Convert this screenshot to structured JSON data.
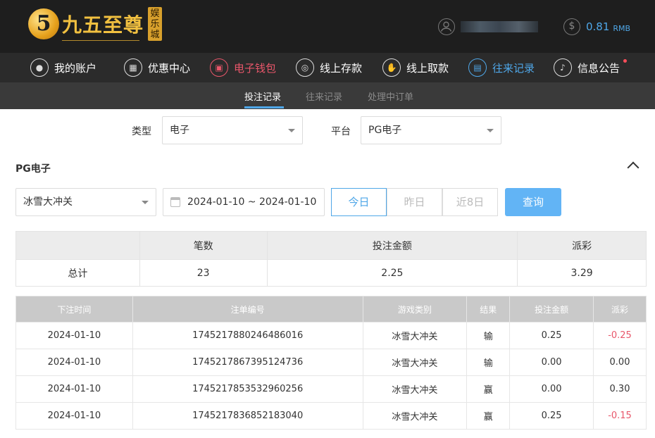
{
  "header": {
    "logo_badge": "5",
    "logo_text": "九五至尊",
    "logo_tag": "娱乐城",
    "balance": "0.81",
    "balance_unit": "RMB"
  },
  "nav": [
    {
      "label": "我的账户",
      "icon": "user-icon"
    },
    {
      "label": "优惠中心",
      "icon": "gift-icon"
    },
    {
      "label": "电子钱包",
      "icon": "wallet-icon"
    },
    {
      "label": "线上存款",
      "icon": "deposit-icon"
    },
    {
      "label": "线上取款",
      "icon": "withdraw-icon"
    },
    {
      "label": "往来记录",
      "icon": "records-icon"
    },
    {
      "label": "信息公告",
      "icon": "bell-icon"
    }
  ],
  "subtabs": [
    "投注记录",
    "往来记录",
    "处理中订单"
  ],
  "filters": {
    "type_label": "类型",
    "type_value": "电子",
    "platform_label": "平台",
    "platform_value": "PG电子"
  },
  "section_title": "PG电子",
  "game_select": "冰雪大冲关",
  "date_range": "2024-01-10 ~ 2024-01-10",
  "range_buttons": [
    "今日",
    "昨日",
    "近8日"
  ],
  "query_label": "查询",
  "summary": {
    "headers": [
      "",
      "笔数",
      "投注金额",
      "派彩"
    ],
    "row": [
      "总计",
      "23",
      "2.25",
      "3.29"
    ]
  },
  "records": {
    "headers": [
      "下注时间",
      "注单编号",
      "游戏类别",
      "结果",
      "投注金额",
      "派彩"
    ],
    "rows": [
      [
        "2024-01-10",
        "1745217880246486016",
        "冰雪大冲关",
        "输",
        "0.25",
        "-0.25"
      ],
      [
        "2024-01-10",
        "1745217867395124736",
        "冰雪大冲关",
        "输",
        "0.00",
        "0.00"
      ],
      [
        "2024-01-10",
        "1745217853532960256",
        "冰雪大冲关",
        "赢",
        "0.00",
        "0.30"
      ],
      [
        "2024-01-10",
        "1745217836852183040",
        "冰雪大冲关",
        "赢",
        "0.25",
        "-0.15"
      ]
    ]
  },
  "colors": {
    "accent_blue": "#4fa7e8",
    "accent_red": "#e8566a",
    "gold": "#f1c040"
  }
}
